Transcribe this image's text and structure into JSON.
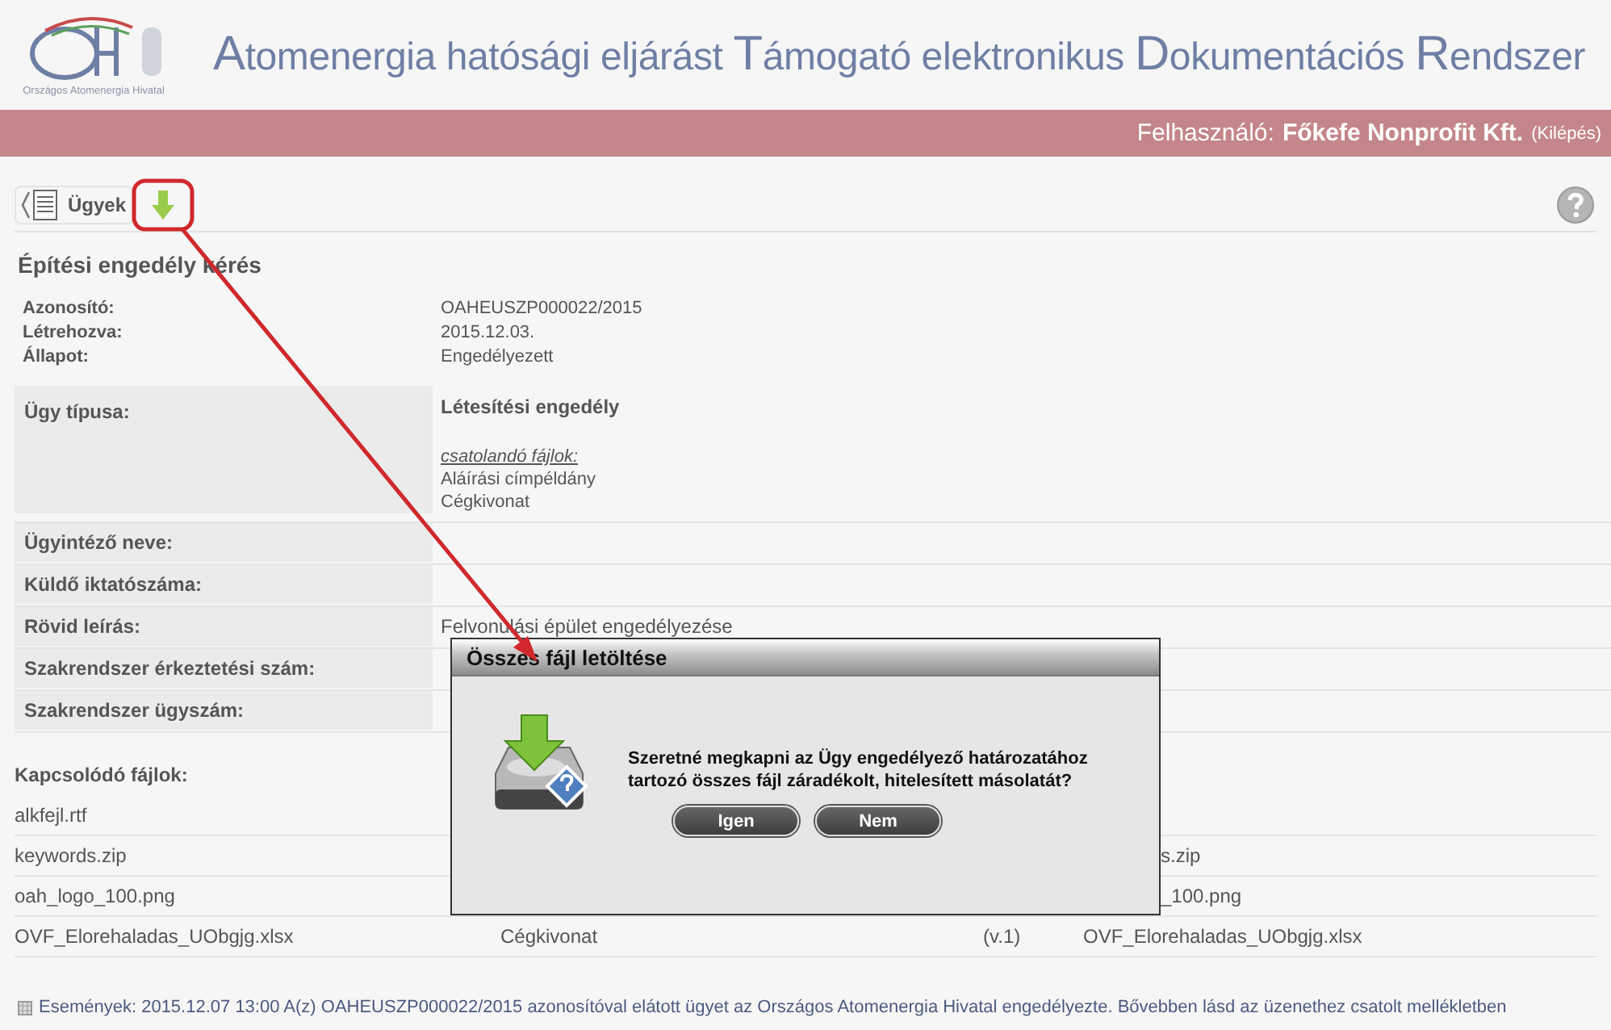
{
  "header": {
    "logo_caption": "Országos Atomenergia Hivatal",
    "title": "Atomenergia hatósági eljárást Támogató elektronikus Dokumentációs Rendszer"
  },
  "user_bar": {
    "label": "Felhasználó:",
    "user": "Főkefe Nonprofit Kft.",
    "logout": "(Kilépés)"
  },
  "toolbar": {
    "back_label": "Ügyek"
  },
  "case": {
    "title": "Építési engedély kérés",
    "meta": [
      {
        "label": "Azonosító:",
        "value": "OAHEUSZP000022/2015"
      },
      {
        "label": "Létrehozva:",
        "value": "2015.12.03."
      },
      {
        "label": "Állapot:",
        "value": "Engedélyezett"
      }
    ],
    "details": [
      {
        "label": "Ügy típusa:",
        "value": "Létesítési engedély",
        "sub_heading": "csatolandó fájlok:",
        "sub_items": [
          "Aláírási címpéldány",
          "Cégkivonat"
        ]
      },
      {
        "label": "Ügyintéző neve:"
      },
      {
        "label": "Küldő iktatószáma:"
      },
      {
        "label": "Rövid leírás:",
        "value": "Felvonulási épület engedélyezése"
      },
      {
        "label": "Szakrendszer érkeztetési szám:"
      },
      {
        "label": "Szakrendszer ügyszám:"
      }
    ]
  },
  "files": {
    "heading": "Kapcsolódó fájlok:",
    "rows": [
      {
        "column_1": "alkfejl.rtf"
      },
      {
        "column_1": "keywords.zip",
        "column_4": "s.zip",
        "column_4_partial": true
      },
      {
        "column_1": "oah_logo_100.png",
        "column_4": "_100.png",
        "column_4_partial": true
      },
      {
        "column_1": "OVF_Elorehaladas_UObgjg.xlsx",
        "column_2": "Cégkivonat",
        "column_3": "(v.1)",
        "column_4": "OVF_Elorehaladas_UObgjg.xlsx"
      }
    ]
  },
  "events": "Események: 2015.12.07 13:00 A(z) OAHEUSZP000022/2015 azonosítóval elátott ügyet az Országos Atomenergia Hivatal engedélyezte. Bővebben lásd az üzenethez csatolt mellékletben",
  "dialog": {
    "title": "Összes fájl letöltése",
    "message": "Szeretné megkapni az Ügy engedélyező határozatához tartozó összes fájl záradékolt, hitelesített másolatát?",
    "buttons": [
      "Igen",
      "Nem"
    ]
  }
}
